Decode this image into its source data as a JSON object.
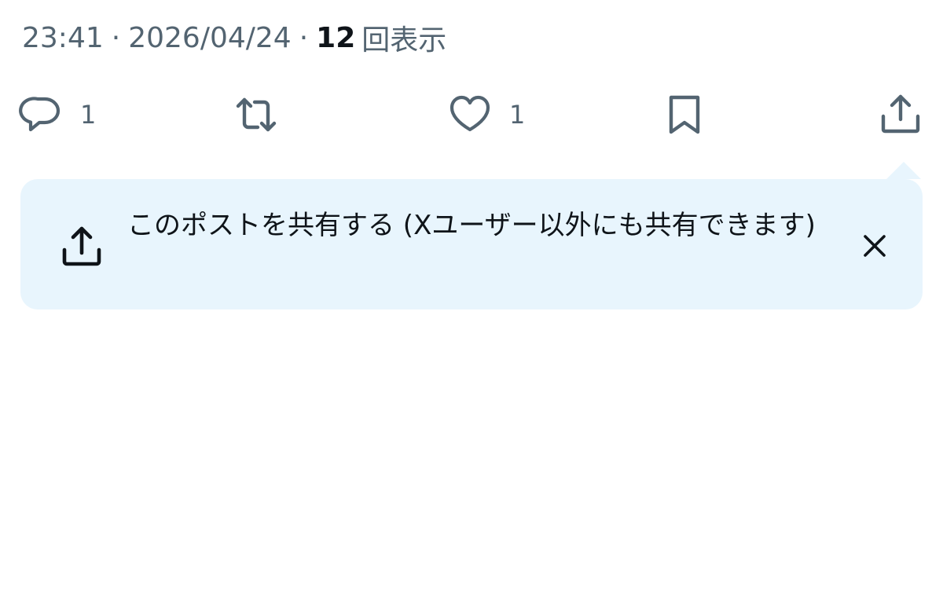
{
  "post_meta": {
    "time": "23:41",
    "date": "2026/04/24",
    "separator": "·",
    "views_count": "12",
    "views_label": "回表示"
  },
  "actions": {
    "reply_count": "1",
    "like_count": "1"
  },
  "share_tip": {
    "text": "このポストを共有する (Xユーザー以外にも共有できます)"
  },
  "icons": {
    "reply": "reply-icon",
    "repost": "repost-icon",
    "like": "heart-icon",
    "bookmark": "bookmark-icon",
    "share": "share-icon",
    "close": "close-icon"
  },
  "colors": {
    "secondary_text": "#536471",
    "primary_text": "#0f1419",
    "tooltip_bg": "#e8f5fd"
  }
}
